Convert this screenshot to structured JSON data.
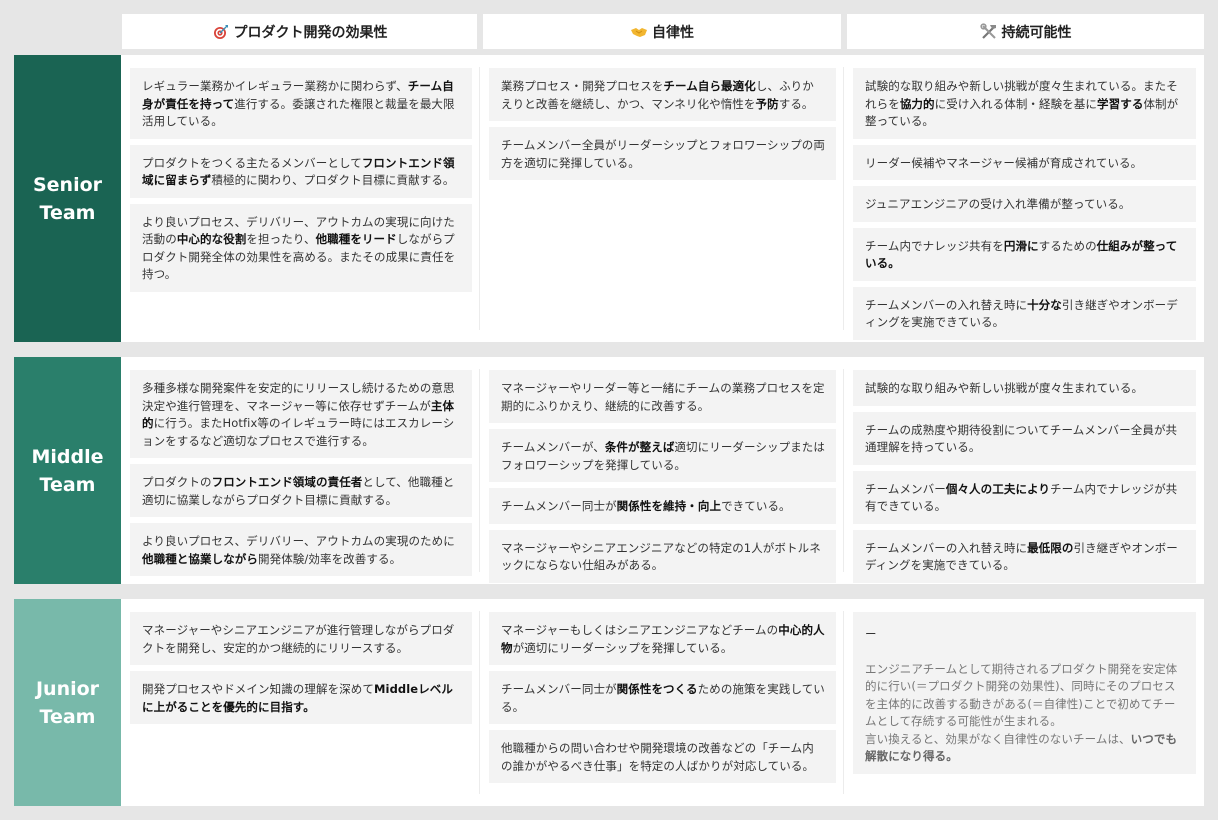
{
  "columns": [
    {
      "icon": "target-icon",
      "glyph": "🎯",
      "label": "プロダクト開発の効果性"
    },
    {
      "icon": "handshake-icon",
      "glyph": "🤝",
      "label": "自律性"
    },
    {
      "icon": "tools-icon",
      "glyph": "🛠",
      "label": "持続可能性"
    }
  ],
  "colors": {
    "senior": "#1a6453",
    "middle": "#2a7f6b",
    "junior": "#78b9aa",
    "card_bg": "#f3f3f3",
    "page_bg": "#e6e6e6"
  },
  "rows": [
    {
      "label_line1": "Senior",
      "label_line2": "Team",
      "cells": [
        [
          [
            {
              "t": "レギュラー業務かイレギュラー業務かに関わらず、"
            },
            {
              "t": "チーム自身が責任を持って",
              "b": true
            },
            {
              "t": "進行する。委譲された権限と裁量を最大限活用している。"
            }
          ],
          [
            {
              "t": "プロダクトをつくる主たるメンバーとして"
            },
            {
              "t": "フロントエンド領域に留まらず",
              "b": true
            },
            {
              "t": "積極的に関わり、プロダクト目標に貢献する。"
            }
          ],
          [
            {
              "t": "より良いプロセス、デリバリー、アウトカムの実現に向けた活動の"
            },
            {
              "t": "中心的な役割",
              "b": true
            },
            {
              "t": "を担ったり、"
            },
            {
              "t": "他職種をリード",
              "b": true
            },
            {
              "t": "しながらプロダクト開発全体の効果性を高める。またその成果に責任を持つ。"
            }
          ]
        ],
        [
          [
            {
              "t": "業務プロセス・開発プロセスを"
            },
            {
              "t": "チーム自ら最適化",
              "b": true
            },
            {
              "t": "し、ふりかえりと改善を継続し、かつ、マンネリ化や惰性を"
            },
            {
              "t": "予防",
              "b": true
            },
            {
              "t": "する。"
            }
          ],
          [
            {
              "t": "チームメンバー全員がリーダーシップとフォロワーシップの両方を適切に発揮している。"
            }
          ]
        ],
        [
          [
            {
              "t": "試験的な取り組みや新しい挑戦が度々生まれている。またそれらを"
            },
            {
              "t": "協力的",
              "b": true
            },
            {
              "t": "に受け入れる体制・経験を基に"
            },
            {
              "t": "学習する",
              "b": true
            },
            {
              "t": "体制が整っている。"
            }
          ],
          [
            {
              "t": "リーダー候補やマネージャー候補が育成されている。"
            }
          ],
          [
            {
              "t": "ジュニアエンジニアの受け入れ準備が整っている。"
            }
          ],
          [
            {
              "t": "チーム内でナレッジ共有を"
            },
            {
              "t": "円滑に",
              "b": true
            },
            {
              "t": "するための"
            },
            {
              "t": "仕組みが整っている。",
              "b": true
            }
          ],
          [
            {
              "t": "チームメンバーの入れ替え時に"
            },
            {
              "t": "十分な",
              "b": true
            },
            {
              "t": "引き継ぎやオンボーディングを実施できている。"
            }
          ]
        ]
      ]
    },
    {
      "label_line1": "Middle",
      "label_line2": "Team",
      "cells": [
        [
          [
            {
              "t": "多種多様な開発案件を安定的にリリースし続けるための意思決定や進行管理を、マネージャー等に依存せずチームが"
            },
            {
              "t": "主体的",
              "b": true
            },
            {
              "t": "に行う。またHotfix等のイレギュラー時にはエスカレーションをするなど適切なプロセスで進行する。"
            }
          ],
          [
            {
              "t": "プロダクトの"
            },
            {
              "t": "フロントエンド領域の責任者",
              "b": true
            },
            {
              "t": "として、他職種と適切に協業しながらプロダクト目標に貢献する。"
            }
          ],
          [
            {
              "t": "より良いプロセス、デリバリー、アウトカムの実現のために"
            },
            {
              "t": "他職種と協業しながら",
              "b": true
            },
            {
              "t": "開発体験/効率を改善する。"
            }
          ]
        ],
        [
          [
            {
              "t": "マネージャーやリーダー等と一緒にチームの業務プロセスを定期的にふりかえり、継続的に改善する。"
            }
          ],
          [
            {
              "t": "チームメンバーが、"
            },
            {
              "t": "条件が整えば",
              "b": true
            },
            {
              "t": "適切にリーダーシップまたはフォロワーシップを発揮している。"
            }
          ],
          [
            {
              "t": "チームメンバー同士が"
            },
            {
              "t": "関係性を維持・向上",
              "b": true
            },
            {
              "t": "できている。"
            }
          ],
          [
            {
              "t": "マネージャーやシニアエンジニアなどの特定の1人がボトルネックにならない仕組みがある。"
            }
          ]
        ],
        [
          [
            {
              "t": "試験的な取り組みや新しい挑戦が度々生まれている。"
            }
          ],
          [
            {
              "t": "チームの成熟度や期待役割についてチームメンバー全員が共通理解を持っている。"
            }
          ],
          [
            {
              "t": "チームメンバー"
            },
            {
              "t": "個々人の工夫により",
              "b": true
            },
            {
              "t": "チーム内でナレッジが共有できている。"
            }
          ],
          [
            {
              "t": "チームメンバーの入れ替え時に"
            },
            {
              "t": "最低限の",
              "b": true
            },
            {
              "t": "引き継ぎやオンボーディングを実施できている。"
            }
          ]
        ]
      ]
    },
    {
      "label_line1": "Junior",
      "label_line2": "Team",
      "cells": [
        [
          [
            {
              "t": "マネージャーやシニアエンジニアが進行管理しながらプロダクトを開発し、安定的かつ継続的にリリースする。"
            }
          ],
          [
            {
              "t": "開発プロセスやドメイン知識の理解を深めて"
            },
            {
              "t": "Middleレベルに上がることを優先的に目指す。",
              "b": true
            }
          ]
        ],
        [
          [
            {
              "t": "マネージャーもしくはシニアエンジニアなどチームの"
            },
            {
              "t": "中心的人物",
              "b": true
            },
            {
              "t": "が適切にリーダーシップを発揮している。"
            }
          ],
          [
            {
              "t": "チームメンバー同士が"
            },
            {
              "t": "関係性をつくる",
              "b": true
            },
            {
              "t": "ための施策を実践している。"
            }
          ],
          [
            {
              "t": "他職種からの問い合わせや開発環境の改善などの「チーム内の誰かがやるべき仕事」を特定の人ばかりが対応している。"
            }
          ]
        ]
      ],
      "note": {
        "dash": "ー",
        "segments": [
          {
            "t": "エンジニアチームとして期待されるプロダクト開発を安定体的に行い(＝プロダクト開発の効果性)、同時にそのプロセスを主体的に改善する動きがある(＝自律性)ことで初めてチームとして存続する可能性が生まれる。"
          },
          {
            "br": true
          },
          {
            "t": "言い換えると、効果がなく自律性のないチームは、"
          },
          {
            "t": "いつでも解散になり得る。",
            "b": true
          }
        ]
      }
    }
  ]
}
